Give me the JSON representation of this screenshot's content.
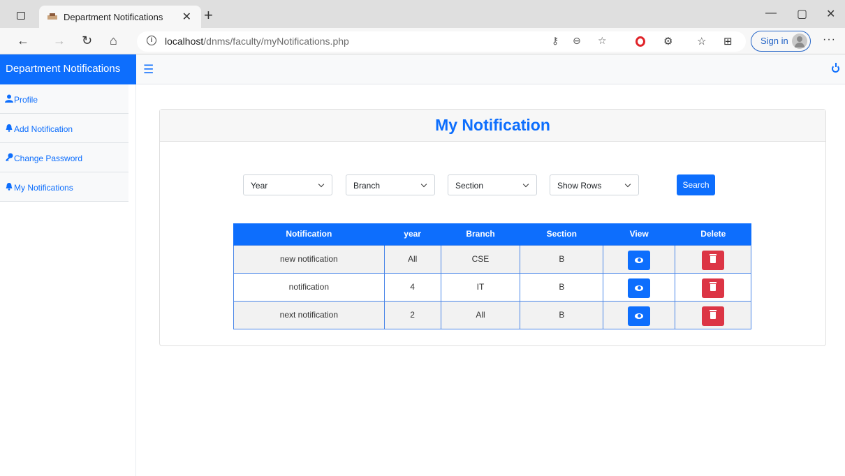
{
  "browser": {
    "tab_title": "Department Notifications",
    "url_host": "localhost",
    "url_path": "/dnms/faculty/myNotifications.php",
    "sign_in": "Sign in"
  },
  "app": {
    "brand": "Department Notifications",
    "accent": "#0d6efd",
    "danger": "#dc3545"
  },
  "sidebar": {
    "items": [
      {
        "label": "Profile",
        "icon": "user-icon"
      },
      {
        "label": "Add Notification",
        "icon": "bell-icon"
      },
      {
        "label": "Change Password",
        "icon": "key-icon"
      },
      {
        "label": "My Notifications",
        "icon": "bell-icon"
      }
    ]
  },
  "page": {
    "title": "My Notification"
  },
  "filters": {
    "year": "Year",
    "branch": "Branch",
    "section": "Section",
    "rows": "Show Rows",
    "search": "Search"
  },
  "table": {
    "headers": [
      "Notification",
      "year",
      "Branch",
      "Section",
      "View",
      "Delete"
    ],
    "rows": [
      [
        "new notification",
        "All",
        "CSE",
        "B"
      ],
      [
        "notification",
        "4",
        "IT",
        "B"
      ],
      [
        "next notification",
        "2",
        "All",
        "B"
      ]
    ]
  }
}
